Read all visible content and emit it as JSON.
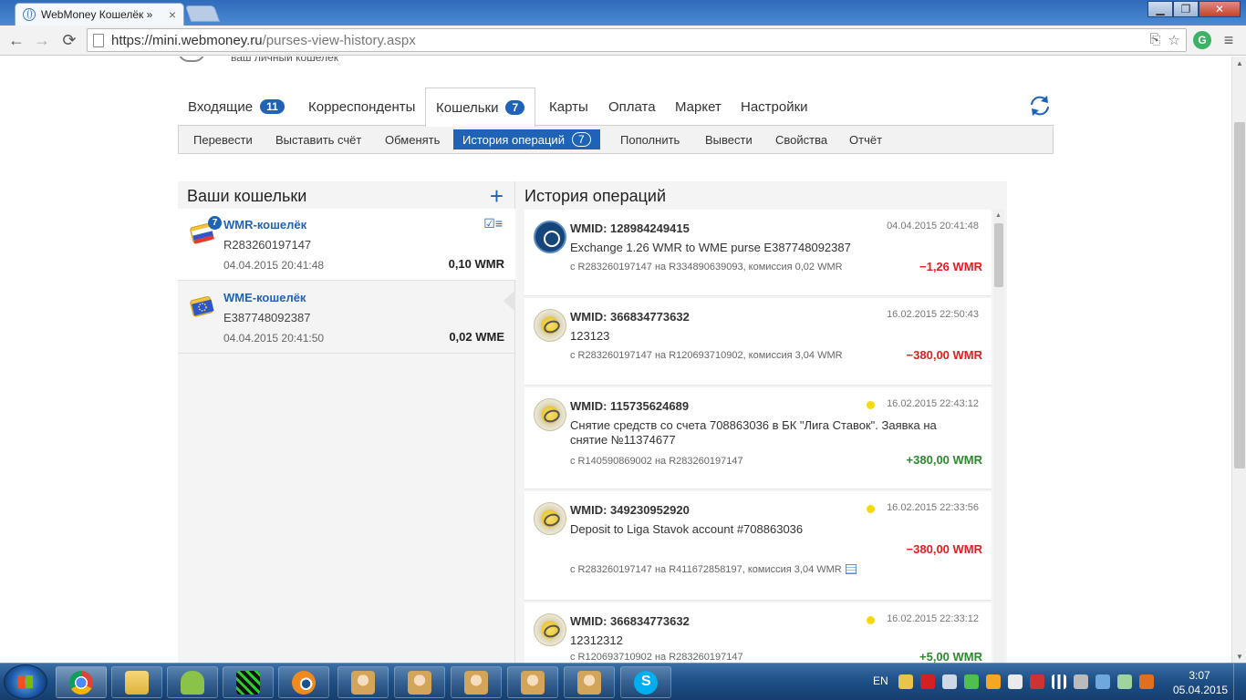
{
  "browser": {
    "tab_title": "WebMoney Кошелёк »",
    "url_host": "https://mini.webmoney.ru",
    "url_path": "/purses-view-history.aspx"
  },
  "header": {
    "tagline": "ваш личный кошелек"
  },
  "main_tabs": [
    {
      "label": "Входящие",
      "badge": "11"
    },
    {
      "label": "Корреспонденты",
      "badge": ""
    },
    {
      "label": "Кошельки",
      "badge": "7"
    },
    {
      "label": "Карты",
      "badge": ""
    },
    {
      "label": "Оплата",
      "badge": ""
    },
    {
      "label": "Маркет",
      "badge": ""
    },
    {
      "label": "Настройки",
      "badge": ""
    }
  ],
  "sub_tabs": [
    {
      "label": "Перевести",
      "count": ""
    },
    {
      "label": "Выставить счёт",
      "count": ""
    },
    {
      "label": "Обменять",
      "count": ""
    },
    {
      "label": "История операций",
      "count": "7"
    },
    {
      "label": "Пополнить",
      "count": ""
    },
    {
      "label": "Вывести",
      "count": ""
    },
    {
      "label": "Свойства",
      "count": ""
    },
    {
      "label": "Отчёт",
      "count": ""
    }
  ],
  "purses_panel": {
    "title": "Ваши кошельки",
    "purses": [
      {
        "name": "WMR-кошелёк",
        "number": "R283260197147",
        "date": "04.04.2015 20:41:48",
        "balance": "0,10 WMR",
        "badge": "7"
      },
      {
        "name": "WME-кошелёк",
        "number": "E387748092387",
        "date": "04.04.2015 20:41:50",
        "balance": "0,02 WME",
        "badge": ""
      }
    ]
  },
  "history": {
    "title": "История операций",
    "items": [
      {
        "wmid": "WMID: 128984249415",
        "date": "04.04.2015 20:41:48",
        "desc": "Exchange 1.26 WMR to WME purse E387748092387",
        "route": "с R283260197147 на R334890639093, комиссия 0,02 WMR",
        "amount": "−1,26 WMR"
      },
      {
        "wmid": "WMID: 366834773632",
        "date": "16.02.2015 22:50:43",
        "desc": "123123",
        "route": "с R283260197147 на R120693710902, комиссия 3,04 WMR",
        "amount": "−380,00 WMR"
      },
      {
        "wmid": "WMID: 115735624689",
        "date": "16.02.2015 22:43:12",
        "desc": "Снятие средств со счета 708863036 в БК \"Лига Ставок\". Заявка на снятие №11374677",
        "route": "с R140590869002 на R283260197147",
        "amount": "+380,00 WMR"
      },
      {
        "wmid": "WMID: 349230952920",
        "date": "16.02.2015 22:33:56",
        "desc": "Deposit to Liga Stavok account #708863036",
        "route": "с R283260197147 на R411672858197, комиссия 3,04 WMR",
        "amount": "−380,00 WMR"
      },
      {
        "wmid": "WMID: 366834773632",
        "date": "16.02.2015 22:33:12",
        "desc": "12312312",
        "route": "с R120693710902 на R283260197147",
        "amount": "+5,00 WMR"
      }
    ]
  },
  "taskbar": {
    "lang": "EN",
    "time": "3:07",
    "date": "05.04.2015"
  },
  "colors": {
    "accent": "#1e63b5",
    "negative": "#e01e1e",
    "positive": "#2b8a2b"
  }
}
